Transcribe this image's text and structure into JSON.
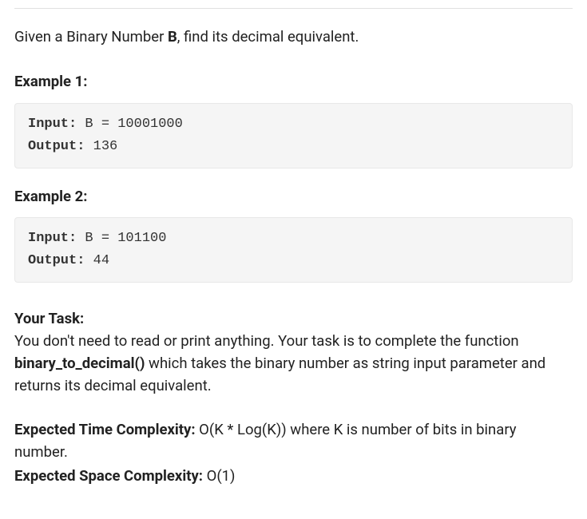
{
  "intro": {
    "prefix": "Given a Binary Number ",
    "bold": "B",
    "suffix": ", find its decimal equivalent."
  },
  "example1": {
    "heading": "Example 1:",
    "inputLabel": "Input:",
    "inputValue": " B = 10001000",
    "outputLabel": "Output:",
    "outputValue": " 136"
  },
  "example2": {
    "heading": "Example 2:",
    "inputLabel": "Input:",
    "inputValue": " B = 101100",
    "outputLabel": "Output:",
    "outputValue": " 44"
  },
  "task": {
    "heading": "Your Task:",
    "textBefore": "You don't need to read or print anything. Your task is to complete the function ",
    "funcName": "binary_to_decimal()",
    "textAfter": " which takes the binary number as string input parameter and returns its decimal equivalent."
  },
  "timeComplexity": {
    "label": "Expected Time Complexity:",
    "value": " O(K * Log(K)) where K is number of bits in binary number."
  },
  "spaceComplexity": {
    "label": "Expected Space Complexity:",
    "value": " O(1)"
  }
}
